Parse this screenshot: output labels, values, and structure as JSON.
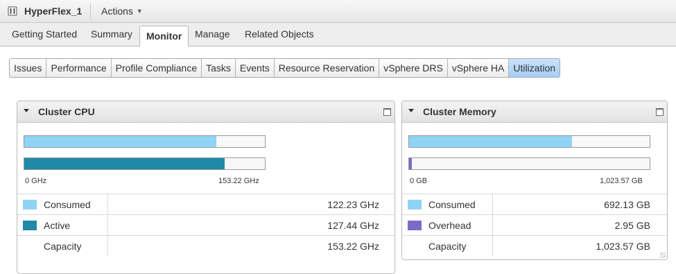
{
  "header": {
    "title": "HyperFlex_1",
    "actions_label": "Actions"
  },
  "nav_tabs": [
    {
      "label": "Getting Started"
    },
    {
      "label": "Summary"
    },
    {
      "label": "Monitor",
      "active": true
    },
    {
      "label": "Manage"
    },
    {
      "label": "Related Objects"
    }
  ],
  "sub_tabs": [
    {
      "label": "Issues"
    },
    {
      "label": "Performance"
    },
    {
      "label": "Profile Compliance"
    },
    {
      "label": "Tasks"
    },
    {
      "label": "Events"
    },
    {
      "label": "Resource Reservation"
    },
    {
      "label": "vSphere DRS"
    },
    {
      "label": "vSphere HA"
    },
    {
      "label": "Utilization",
      "active": true
    }
  ],
  "cpu": {
    "title": "Cluster CPU",
    "axis_min": "0 GHz",
    "axis_max": "153.22 GHz",
    "consumed_fraction": 0.798,
    "active_fraction": 0.832,
    "rows": [
      {
        "label": "Consumed",
        "value": "122.23 GHz",
        "color": "#8fd3f5"
      },
      {
        "label": "Active",
        "value": "127.44 GHz",
        "color": "#2089a8"
      },
      {
        "label": "Capacity",
        "value": "153.22 GHz",
        "color": ""
      }
    ]
  },
  "memory": {
    "title": "Cluster Memory",
    "axis_min": "0 GB",
    "axis_max": "1,023.57 GB",
    "consumed_fraction": 0.676,
    "overhead_fraction": 0.0029,
    "rows": [
      {
        "label": "Consumed",
        "value": "692.13 GB",
        "color": "#8fd3f5"
      },
      {
        "label": "Overhead",
        "value": "2.95 GB",
        "color": "#7a6cc6"
      },
      {
        "label": "Capacity",
        "value": "1,023.57 GB",
        "color": ""
      }
    ]
  }
}
